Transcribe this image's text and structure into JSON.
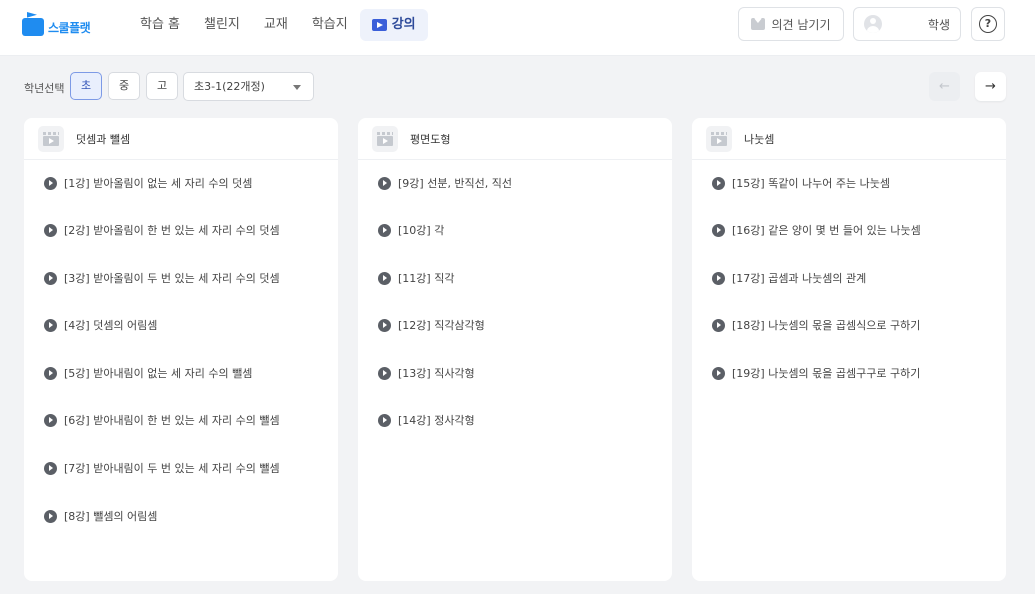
{
  "header": {
    "logo_text": "스쿨플랫",
    "nav": [
      {
        "label": "학습 홈"
      },
      {
        "label": "챌린지"
      },
      {
        "label": "교재"
      },
      {
        "label": "학습지"
      },
      {
        "label": "강의",
        "active": true
      }
    ],
    "feedback_label": "의견 남기기",
    "profile_role": "학생",
    "help_symbol": "?"
  },
  "filter": {
    "label": "학년선택",
    "grades": [
      "초",
      "중",
      "고"
    ],
    "selected_grade": "초",
    "course_select": "초3-1(22개정)",
    "prev_arrow": "←",
    "next_arrow": "→"
  },
  "units": [
    {
      "title": "덧셈과 뺄셈",
      "lessons": [
        "[1강] 받아올림이 없는 세 자리 수의 덧셈",
        "[2강] 받아올림이 한 번 있는 세 자리 수의 덧셈",
        "[3강] 받아올림이 두 번 있는 세 자리 수의 덧셈",
        "[4강] 덧셈의 어림셈",
        "[5강] 받아내림이 없는 세 자리 수의 뺄셈",
        "[6강] 받아내림이 한 번 있는 세 자리 수의 뺄셈",
        "[7강] 받아내림이 두 번 있는 세 자리 수의 뺄셈",
        "[8강] 뺄셈의 어림셈"
      ]
    },
    {
      "title": "평면도형",
      "lessons": [
        "[9강] 선분, 반직선, 직선",
        "[10강] 각",
        "[11강] 직각",
        "[12강] 직각삼각형",
        "[13강] 직사각형",
        "[14강] 정사각형"
      ]
    },
    {
      "title": "나눗셈",
      "lessons": [
        "[15강] 똑같이 나누어 주는 나눗셈",
        "[16강] 같은 양이 몇 번 들어 있는 나눗셈",
        "[17강] 곱셈과 나눗셈의 관계",
        "[18강] 나눗셈의 몫을 곱셈식으로 구하기",
        "[19강] 나눗셈의 몫을 곱셈구구로 구하기"
      ]
    }
  ],
  "colors": {
    "brand": "#1f8cf0",
    "active_nav_bg": "#eef2fb",
    "active_nav_text": "#2d4a9a",
    "page_bg": "#f2f3f5"
  }
}
